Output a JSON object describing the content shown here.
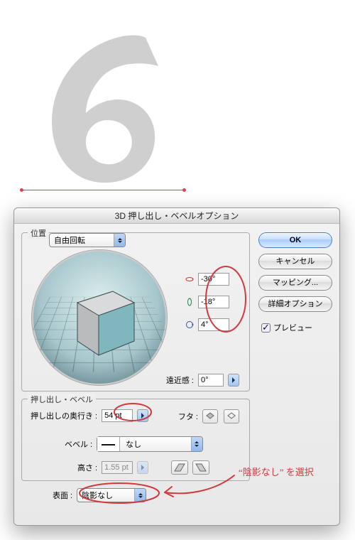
{
  "dialog": {
    "title": "3D 押し出し・ベベルオプション",
    "position_group": {
      "legend": "位置",
      "combo_value": "自由回転",
      "rot_x": "-30°",
      "rot_y": "-18°",
      "rot_z": "4°",
      "perspective_label": "遠近感 :",
      "perspective_value": "0°"
    },
    "extrude_group": {
      "legend": "押し出し・ベベル",
      "depth_label": "押し出しの奥行き :",
      "depth_value": "54 pt",
      "cap_label": "フタ :",
      "bevel_label": "ベベル :",
      "bevel_value": "なし",
      "height_label": "高さ :",
      "height_value": "1.55 pt"
    },
    "surface": {
      "label": "表面 :",
      "value": "陰影なし"
    },
    "buttons": {
      "ok": "OK",
      "cancel": "キャンセル",
      "mapping": "マッピング...",
      "more": "詳細オプション",
      "preview": "プレビュー"
    }
  },
  "annotation": {
    "text": "“陰影なし” を選択"
  }
}
